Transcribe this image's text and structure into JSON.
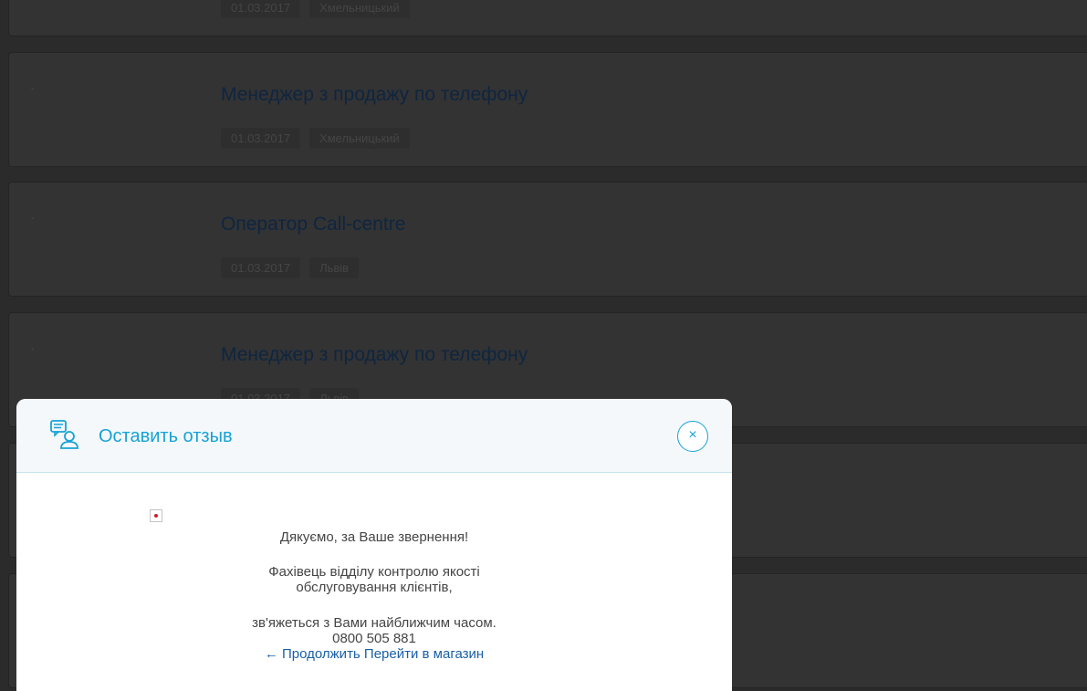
{
  "job_list": {
    "items": [
      {
        "title": "",
        "date": "01.03.2017",
        "city": "Хмельницький"
      },
      {
        "title": "Менеджер з продажу по телефону",
        "date": "01.03.2017",
        "city": "Хмельницький"
      },
      {
        "title": "Оператор Call-centre",
        "date": "01.03.2017",
        "city": "Львів"
      },
      {
        "title": "Менеджер з продажу по телефону",
        "date": "01.03.2017",
        "city": "Львів"
      }
    ]
  },
  "modal": {
    "title": "Оставить отзыв",
    "close_label": "×",
    "thanks": "Дякуємо, за Ваше звернення!",
    "specialist_line1": "Фахівець відділу контролю якості",
    "specialist_line2": "обслуговування клієнтів,",
    "contact": "зв'яжеться з Вами найближчим часом.",
    "phone": "0800 505 881",
    "continue_link": "← Продолжить",
    "shop_link": "Перейти в магазин"
  },
  "colors": {
    "accent": "#16a2d6",
    "link": "#1a5fa6",
    "background": "#2b2b2b"
  }
}
